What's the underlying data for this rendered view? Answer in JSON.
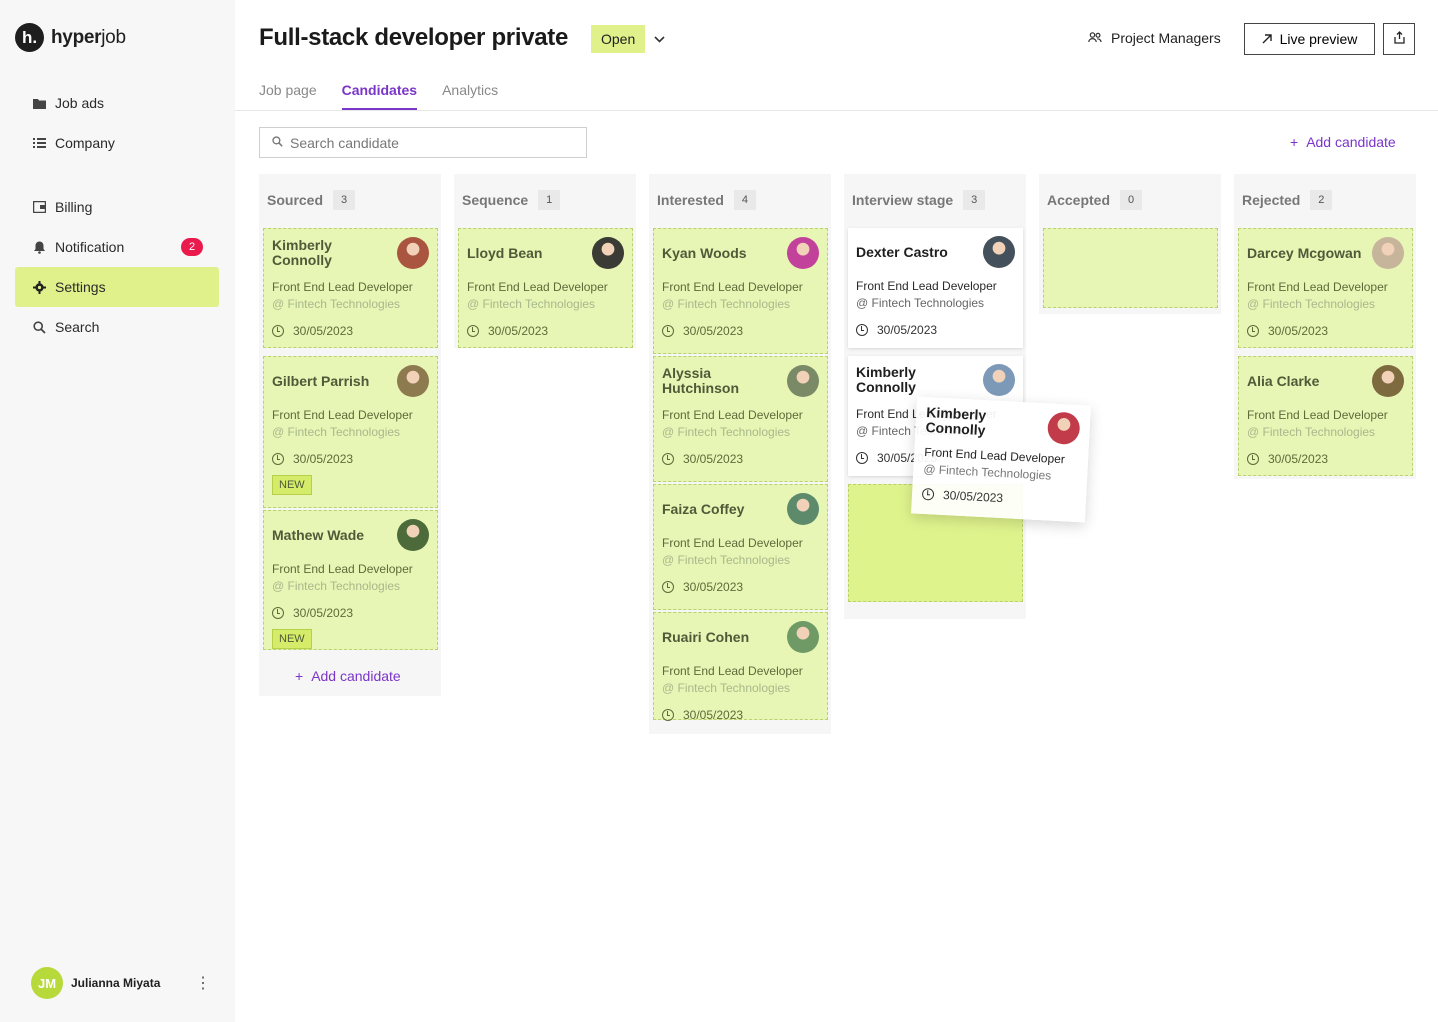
{
  "app": {
    "logo_mark": "h.",
    "logo_bold": "hyper",
    "logo_light": "job"
  },
  "sidebar": {
    "items": [
      {
        "label": "Job ads",
        "icon": "folder-icon"
      },
      {
        "label": "Company",
        "icon": "list-icon"
      },
      {
        "label": "Billing",
        "icon": "wallet-icon"
      },
      {
        "label": "Notification",
        "icon": "bell-icon",
        "badge": "2"
      },
      {
        "label": "Settings",
        "icon": "gear-icon",
        "active": true
      },
      {
        "label": "Search",
        "icon": "search-icon"
      }
    ],
    "user": {
      "initials": "JM",
      "name": "Julianna Miyata"
    }
  },
  "header": {
    "title": "Full-stack developer private",
    "status": "Open",
    "project_managers": "Project Managers",
    "live_preview": "Live preview"
  },
  "tabs": [
    {
      "label": "Job page",
      "active": false
    },
    {
      "label": "Candidates",
      "active": true
    },
    {
      "label": "Analytics",
      "active": false
    }
  ],
  "search": {
    "placeholder": "Search candidate"
  },
  "add_candidate": "Add candidate",
  "columns": [
    {
      "title": "Sourced",
      "count": "3",
      "cards": [
        {
          "name": "Kimberly Connolly",
          "role": "Front End Lead Developer",
          "company": "@ Fintech Technologies",
          "date": "30/05/2023",
          "new": false,
          "photo_color": "#a9553f"
        },
        {
          "name": "Gilbert Parrish",
          "role": "Front End Lead Developer",
          "company": "@ Fintech Technologies",
          "date": "30/05/2023",
          "new": true,
          "photo_color": "#8d7a4f"
        },
        {
          "name": "Mathew Wade",
          "role": "Front End Lead Developer",
          "company": "@ Fintech Technologies",
          "date": "30/05/2023",
          "new": true,
          "photo_color": "#4d6b3a"
        }
      ]
    },
    {
      "title": "Sequence",
      "count": "1",
      "cards": [
        {
          "name": "Lloyd Bean",
          "role": "Front End Lead Developer",
          "company": "@ Fintech Technologies",
          "date": "30/05/2023",
          "new": false,
          "photo_color": "#3b3b36"
        }
      ]
    },
    {
      "title": "Interested",
      "count": "4",
      "cards": [
        {
          "name": "Kyan Woods",
          "role": "Front End Lead Developer",
          "company": "@ Fintech Technologies",
          "date": "30/05/2023",
          "new": false,
          "photo_color": "#c2419a"
        },
        {
          "name": "Alyssia Hutchinson",
          "role": "Front End Lead Developer",
          "company": "@ Fintech Technologies",
          "date": "30/05/2023",
          "new": false,
          "photo_color": "#7a8a67"
        },
        {
          "name": "Faiza Coffey",
          "role": "Front End Lead Developer",
          "company": "@ Fintech Technologies",
          "date": "30/05/2023",
          "new": false,
          "photo_color": "#5e8a6c"
        },
        {
          "name": "Ruairi Cohen",
          "role": "Front End Lead Developer",
          "company": "@ Fintech Technologies",
          "date": "30/05/2023",
          "new": false,
          "photo_color": "#6f9a66"
        }
      ]
    },
    {
      "title": "Interview stage",
      "count": "3",
      "cards": [
        {
          "name": "Dexter Castro",
          "role": "Front End Lead Developer",
          "company": "@ Fintech Technologies",
          "date": "30/05/2023",
          "new": false,
          "photo_color": "#44505c"
        },
        {
          "name": "Kimberly Connolly",
          "role": "Front End Lead Developer",
          "company": "@ Fintech Technologies",
          "date": "30/05/2023",
          "new": false,
          "photo_color": "#7c9ab8"
        }
      ]
    },
    {
      "title": "Accepted",
      "count": "0",
      "cards": []
    },
    {
      "title": "Rejected",
      "count": "2",
      "cards": [
        {
          "name": "Darcey Mcgowan",
          "role": "Front End Lead Developer",
          "company": "@ Fintech Technologies",
          "date": "30/05/2023",
          "new": false,
          "photo_color": "#c6b49b"
        },
        {
          "name": "Alia Clarke",
          "role": "Front End Lead Developer",
          "company": "@ Fintech Technologies",
          "date": "30/05/2023",
          "new": false,
          "photo_color": "#7d6a3f"
        }
      ]
    }
  ],
  "new_label": "NEW",
  "dragging_card": {
    "name": "Kimberly Connolly",
    "role": "Front End Lead Developer",
    "company": "@ Fintech Technologies",
    "date": "30/05/2023",
    "photo_color": "#c23b4a"
  },
  "colors": {
    "accent": "#7a35c9",
    "highlight": "#e0f08a",
    "card": "#e7f5b5",
    "badge": "#ea1b4c"
  }
}
